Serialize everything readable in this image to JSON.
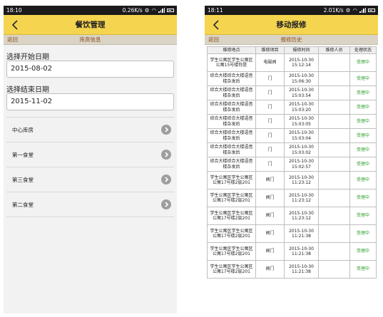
{
  "left": {
    "status": {
      "time": "18:10",
      "speed": "0.26K/s"
    },
    "title": "餐饮管理",
    "subbar": {
      "back": "返回",
      "title": "库房信息"
    },
    "start_label": "选择开始日期",
    "start_value": "2015-08-02",
    "end_label": "选择结束日期",
    "end_value": "2015-11-02",
    "warehouses": [
      {
        "label": "中心库房"
      },
      {
        "label": "第一食堂"
      },
      {
        "label": "第三食堂"
      },
      {
        "label": "第二食堂"
      }
    ]
  },
  "right": {
    "status": {
      "time": "18:11",
      "speed": "2.01K/s"
    },
    "title": "移动报修",
    "subbar": {
      "back": "返回",
      "title": "报修历史"
    },
    "columns": [
      "维修地点",
      "维修项目",
      "报修时间",
      "维修人员",
      "处理状态"
    ],
    "rows": [
      {
        "location": "学生公寓区学生公寓区公寓15号楼你是",
        "item": "电磁阀",
        "time": "2015-10-30 15:12:14",
        "staff": "",
        "status": "受理中"
      },
      {
        "location": "综合大楼综合大楼语音楼杂发后",
        "item": "门",
        "time": "2015-10-30 15:06:30",
        "staff": "",
        "status": "受理中"
      },
      {
        "location": "综合大楼综合大楼语音楼杂发后",
        "item": "门",
        "time": "2015-10-30 15:03:54",
        "staff": "",
        "status": "受理中"
      },
      {
        "location": "综合大楼综合大楼语音楼杂发后",
        "item": "门",
        "time": "2015-10-30 15:03:20",
        "staff": "",
        "status": "受理中"
      },
      {
        "location": "综合大楼综合大楼语音楼杂发后",
        "item": "门",
        "time": "2015-10-30 15:03:05",
        "staff": "",
        "status": "受理中"
      },
      {
        "location": "综合大楼综合大楼语音楼杂发后",
        "item": "门",
        "time": "2015-10-30 15:03:04",
        "staff": "",
        "status": "受理中"
      },
      {
        "location": "综合大楼综合大楼语音楼杂发后",
        "item": "门",
        "time": "2015-10-30 15:03:02",
        "staff": "",
        "status": "受理中"
      },
      {
        "location": "综合大楼综合大楼语音楼杂发后",
        "item": "门",
        "time": "2015-10-30 15:02:57",
        "staff": "",
        "status": "受理中"
      },
      {
        "location": "学生公寓区学生公寓区公寓17号楼2层201",
        "item": "阀门",
        "time": "2015-10-30 11:23:12",
        "staff": "",
        "status": "受理中"
      },
      {
        "location": "学生公寓区学生公寓区公寓17号楼2层201",
        "item": "阀门",
        "time": "2015-10-30 11:23:12",
        "staff": "",
        "status": "受理中"
      },
      {
        "location": "学生公寓区学生公寓区公寓17号楼2层201",
        "item": "阀门",
        "time": "2015-10-30 11:23:12",
        "staff": "",
        "status": "受理中"
      },
      {
        "location": "学生公寓区学生公寓区公寓17号楼2层201",
        "item": "阀门",
        "time": "2015-10-30 11:21:38",
        "staff": "",
        "status": "受理中"
      },
      {
        "location": "学生公寓区学生公寓区公寓17号楼2层201",
        "item": "阀门",
        "time": "2015-10-30 11:21:38",
        "staff": "",
        "status": "受理中"
      },
      {
        "location": "学生公寓区学生公寓区公寓17号楼2层201",
        "item": "阀门",
        "time": "2015-10-30 11:21:38",
        "staff": "",
        "status": "受理中"
      }
    ]
  },
  "colors": {
    "titlebar": "#f5d44f",
    "subbar": "#d9d4c5",
    "status_green": "#2f9e2f"
  }
}
